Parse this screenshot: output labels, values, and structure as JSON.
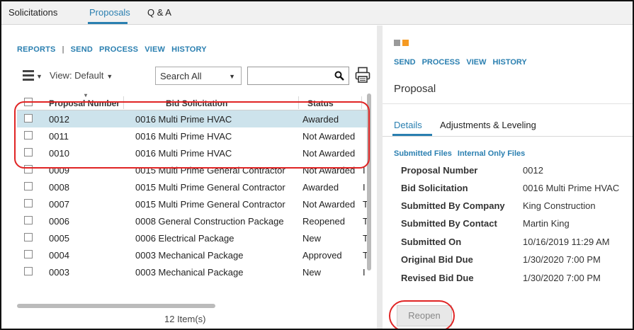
{
  "top_tabs": [
    {
      "label": "Solicitations"
    },
    {
      "label": "Proposals"
    },
    {
      "label": "Q & A"
    }
  ],
  "active_top_tab": "Proposals",
  "left_actions": {
    "reports": "REPORTS",
    "separator": "|",
    "send": "SEND",
    "process": "PROCESS",
    "view": "VIEW",
    "history": "HISTORY"
  },
  "toolbar": {
    "view_label": "View: Default",
    "search_select": "Search All",
    "search_value": ""
  },
  "grid": {
    "headers": {
      "number": "Proposal Number",
      "solicitation": "Bid Solicitation",
      "status": "Status"
    },
    "rows": [
      {
        "number": "0012",
        "solicitation": "0016 Multi Prime HVAC",
        "status": "Awarded",
        "extra": ""
      },
      {
        "number": "0011",
        "solicitation": "0016 Multi Prime HVAC",
        "status": "Not Awarded",
        "extra": ""
      },
      {
        "number": "0010",
        "solicitation": "0016 Multi Prime HVAC",
        "status": "Not Awarded",
        "extra": ""
      },
      {
        "number": "0009",
        "solicitation": "0015 Multi Prime General Contractor",
        "status": "Not Awarded",
        "extra": "I"
      },
      {
        "number": "0008",
        "solicitation": "0015 Multi Prime General Contractor",
        "status": "Awarded",
        "extra": "I"
      },
      {
        "number": "0007",
        "solicitation": "0015 Multi Prime General Contractor",
        "status": "Not Awarded",
        "extra": "T"
      },
      {
        "number": "0006",
        "solicitation": "0008 General Construction Package",
        "status": "Reopened",
        "extra": "T"
      },
      {
        "number": "0005",
        "solicitation": "0006 Electrical Package",
        "status": "New",
        "extra": "T"
      },
      {
        "number": "0004",
        "solicitation": "0003 Mechanical Package",
        "status": "Approved",
        "extra": "T"
      },
      {
        "number": "0003",
        "solicitation": "0003 Mechanical Package",
        "status": "New",
        "extra": "I"
      }
    ],
    "item_count": "12 Item(s)"
  },
  "right_actions": {
    "send": "SEND",
    "process": "PROCESS",
    "view": "VIEW",
    "history": "HISTORY"
  },
  "right": {
    "title": "Proposal",
    "tabs": [
      {
        "label": "Details"
      },
      {
        "label": "Adjustments & Leveling"
      }
    ],
    "file_links": {
      "submitted": "Submitted Files",
      "internal": "Internal Only Files"
    },
    "details": [
      {
        "label": "Proposal Number",
        "value": "0012"
      },
      {
        "label": "Bid Solicitation",
        "value": "0016 Multi Prime HVAC"
      },
      {
        "label": "Submitted By Company",
        "value": "King Construction"
      },
      {
        "label": "Submitted By Contact",
        "value": "Martin King"
      },
      {
        "label": "Submitted On",
        "value": "10/16/2019 11:29 AM"
      },
      {
        "label": "Original Bid Due",
        "value": "1/30/2020 7:00 PM"
      },
      {
        "label": "Revised Bid Due",
        "value": "1/30/2020 7:00 PM"
      }
    ],
    "reopen_label": "Reopen"
  },
  "colors": {
    "accent": "#2a7fb0",
    "selected_row": "#cde3ec",
    "annotation": "#e02424",
    "square_gray": "#9a9a9a",
    "square_orange": "#f59a23"
  }
}
